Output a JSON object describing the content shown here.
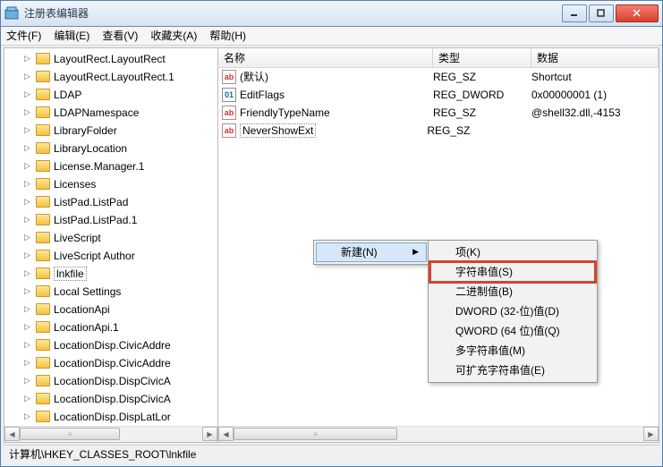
{
  "window": {
    "title": "注册表编辑器"
  },
  "menu": {
    "file": "文件(F)",
    "edit": "编辑(E)",
    "view": "查看(V)",
    "fav": "收藏夹(A)",
    "help": "帮助(H)"
  },
  "tree": {
    "items": [
      {
        "label": "LayoutRect.LayoutRect"
      },
      {
        "label": "LayoutRect.LayoutRect.1"
      },
      {
        "label": "LDAP"
      },
      {
        "label": "LDAPNamespace"
      },
      {
        "label": "LibraryFolder"
      },
      {
        "label": "LibraryLocation"
      },
      {
        "label": "License.Manager.1"
      },
      {
        "label": "Licenses"
      },
      {
        "label": "ListPad.ListPad"
      },
      {
        "label": "ListPad.ListPad.1"
      },
      {
        "label": "LiveScript"
      },
      {
        "label": "LiveScript Author"
      },
      {
        "label": "lnkfile",
        "selected": true
      },
      {
        "label": "Local Settings"
      },
      {
        "label": "LocationApi"
      },
      {
        "label": "LocationApi.1"
      },
      {
        "label": "LocationDisp.CivicAddre"
      },
      {
        "label": "LocationDisp.CivicAddre"
      },
      {
        "label": "LocationDisp.DispCivicA"
      },
      {
        "label": "LocationDisp.DispCivicA"
      },
      {
        "label": "LocationDisp.DispLatLor"
      }
    ]
  },
  "list": {
    "col_name": "名称",
    "col_type": "类型",
    "col_data": "数据",
    "rows": [
      {
        "icon": "str",
        "name": "(默认)",
        "type": "REG_SZ",
        "data": "Shortcut"
      },
      {
        "icon": "bin",
        "name": "EditFlags",
        "type": "REG_DWORD",
        "data": "0x00000001 (1)"
      },
      {
        "icon": "str",
        "name": "FriendlyTypeName",
        "type": "REG_SZ",
        "data": "@shell32.dll,-4153"
      },
      {
        "icon": "str",
        "name": "NeverShowExt",
        "type": "REG_SZ",
        "data": "",
        "selected": true
      }
    ]
  },
  "context_parent": {
    "new": "新建(N)"
  },
  "context_sub": {
    "items": [
      {
        "label": "项(K)"
      },
      {
        "label": "字符串值(S)",
        "highlight": true
      },
      {
        "label": "二进制值(B)"
      },
      {
        "label": "DWORD (32-位)值(D)"
      },
      {
        "label": "QWORD (64 位)值(Q)"
      },
      {
        "label": "多字符串值(M)"
      },
      {
        "label": "可扩充字符串值(E)"
      }
    ]
  },
  "statusbar": {
    "path": "计算机\\HKEY_CLASSES_ROOT\\lnkfile"
  }
}
